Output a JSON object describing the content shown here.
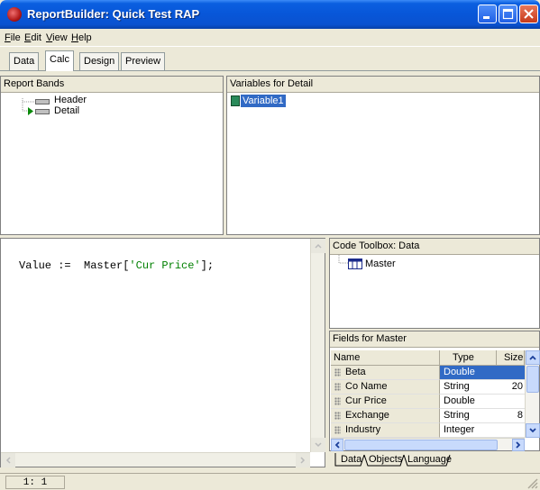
{
  "window": {
    "title": "ReportBuilder: Quick Test RAP"
  },
  "menu": [
    {
      "hot": "F",
      "rest": "ile"
    },
    {
      "hot": "E",
      "rest": "dit"
    },
    {
      "hot": "V",
      "rest": "iew"
    },
    {
      "hot": "H",
      "rest": "elp"
    }
  ],
  "tabs": [
    "Data",
    "Calc",
    "Design",
    "Preview"
  ],
  "active_tab": "Calc",
  "report_bands": {
    "title": "Report Bands",
    "items": [
      "Header",
      "Detail"
    ],
    "selected": "Detail"
  },
  "variables": {
    "title": "Variables for Detail",
    "items": [
      "Variable1"
    ]
  },
  "code": {
    "prefix": "Value :=  Master[",
    "string": "'Cur Price'",
    "suffix": "];"
  },
  "toolbox": {
    "title": "Code Toolbox: Data",
    "items": [
      "Master"
    ]
  },
  "fields": {
    "title": "Fields for Master",
    "columns": [
      "Name",
      "Type",
      "Size"
    ],
    "rows": [
      {
        "name": "Beta",
        "type": "Double",
        "size": ""
      },
      {
        "name": "Co Name",
        "type": "String",
        "size": "20"
      },
      {
        "name": "Cur Price",
        "type": "Double",
        "size": ""
      },
      {
        "name": "Exchange",
        "type": "String",
        "size": "8"
      },
      {
        "name": "Industry",
        "type": "Integer",
        "size": ""
      }
    ],
    "selected_row": 0
  },
  "bottom_tabs": [
    "Data",
    "Objects",
    "Language"
  ],
  "bottom_active": "Data",
  "status": {
    "position": "1: 1"
  },
  "colors": {
    "titlebar": "#0a5fe0",
    "selection": "#316ac5",
    "code_string": "#008000"
  }
}
